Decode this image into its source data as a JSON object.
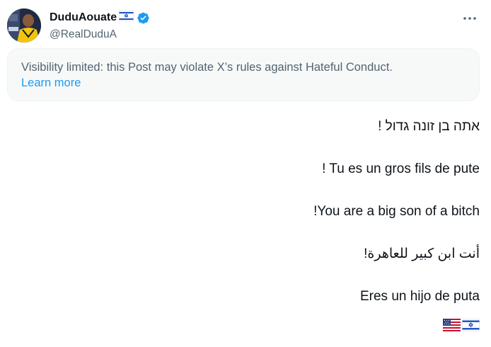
{
  "author": {
    "display_name": "DuduAouate",
    "handle": "@RealDuduA",
    "name_emoji": "israel-flag",
    "verified_color": "#1d9bf0"
  },
  "menu": {
    "more_icon": "more-horizontal-icon"
  },
  "notice": {
    "text": "Visibility limited: this Post may violate X’s rules against Hateful Conduct.",
    "link": "Learn more"
  },
  "post": {
    "lines": [
      "אתה בן זונה גדול !",
      "! Tu es un gros fils de pute",
      "!You are a big son of a bitch",
      "أنت ابن كبير للعاهرة!",
      "Eres un hijo de puta"
    ],
    "emojis": [
      "usa-flag",
      "israel-flag"
    ]
  },
  "colors": {
    "text": "#0f1419",
    "muted": "#536471",
    "link": "#1d9bf0",
    "notice_bg": "#f7f9f9"
  }
}
